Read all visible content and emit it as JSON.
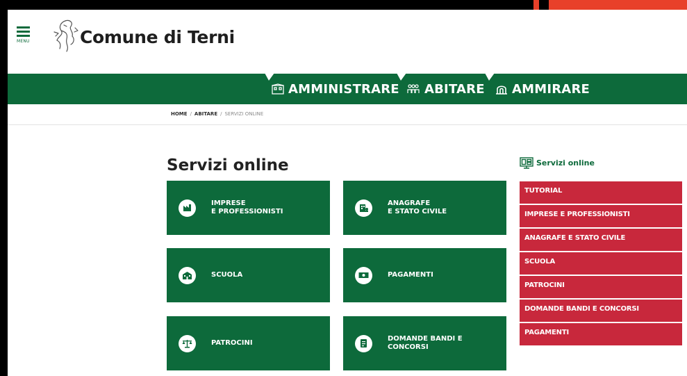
{
  "header": {
    "menu_label": "MENU",
    "site_title": "Comune di Terni"
  },
  "nav": {
    "items": [
      {
        "label": "AMMINISTRARE",
        "icon": "building-icon"
      },
      {
        "label": "ABITARE",
        "icon": "people-icon"
      },
      {
        "label": "AMMIRARE",
        "icon": "arch-icon"
      }
    ]
  },
  "breadcrumb": {
    "items": [
      "HOME",
      "ABITARE",
      "SERVIZI ONLINE"
    ],
    "separator": "/"
  },
  "main": {
    "title": "Servizi online",
    "tiles": [
      {
        "line1": "IMPRESE",
        "line2": "E PROFESSIONISTI",
        "icon": "factory-icon"
      },
      {
        "line1": "ANAGRAFE",
        "line2": "E STATO CIVILE",
        "icon": "id-card-icon"
      },
      {
        "line1": "SCUOLA",
        "line2": "",
        "icon": "school-icon"
      },
      {
        "line1": "PAGAMENTI",
        "line2": "",
        "icon": "money-icon"
      },
      {
        "line1": "PATROCINI",
        "line2": "",
        "icon": "scales-icon"
      },
      {
        "line1": "DOMANDE BANDI E",
        "line2": "CONCORSI",
        "icon": "document-icon"
      }
    ]
  },
  "sidebar": {
    "heading": "Servizi online",
    "items": [
      {
        "label": "TUTORIAL"
      },
      {
        "label": "IMPRESE E PROFESSIONISTI"
      },
      {
        "label": "ANAGRAFE E STATO CIVILE"
      },
      {
        "label": "SCUOLA"
      },
      {
        "label": "PATROCINI"
      },
      {
        "label": "DOMANDE BANDI E CONCORSI"
      },
      {
        "label": "PAGAMENTI"
      }
    ]
  },
  "colors": {
    "primary_green": "#0d6a3b",
    "sidebar_red": "#c8283c",
    "accent_orange": "#e8402a"
  }
}
